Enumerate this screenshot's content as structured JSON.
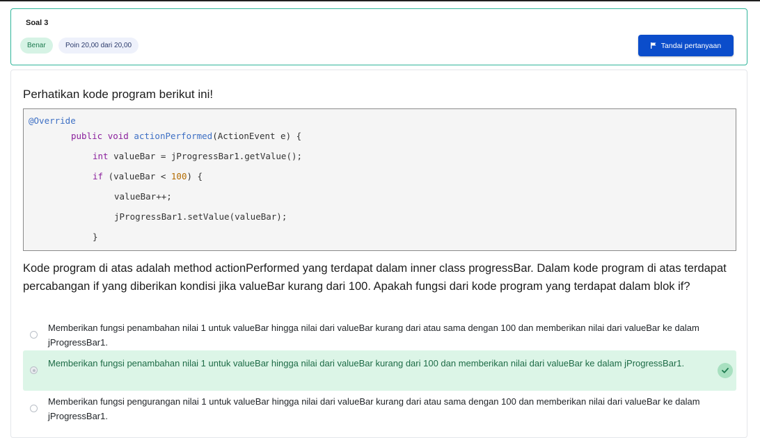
{
  "header": {
    "title": "Soal 3",
    "status_badge": "Benar",
    "points_badge": "Poin 20,00 dari 20,00",
    "flag_button_label": "Tandai pertanyaan"
  },
  "question": {
    "intro": "Perhatikan kode program berikut ini!",
    "code_lines": [
      "@Override",
      "public void actionPerformed(ActionEvent e) {",
      "int valueBar = jProgressBar1.getValue();",
      "if (valueBar < 100) {",
      "valueBar++;",
      "jProgressBar1.setValue(valueBar);",
      "}"
    ],
    "text": "Kode program di atas adalah method actionPerformed yang terdapat dalam inner class progressBar. Dalam kode program di atas terdapat percabangan if yang diberikan kondisi jika valueBar kurang dari 100. Apakah fungsi dari kode program yang terdapat dalam blok if?"
  },
  "options": [
    {
      "text": "Memberikan fungsi penambahan nilai 1 untuk valueBar hingga nilai dari valueBar kurang dari atau sama dengan 100 dan memberikan nilai dari valueBar ke dalam jProgressBar1.",
      "selected": false
    },
    {
      "text": "Memberikan fungsi penambahan nilai 1 untuk valueBar hingga nilai dari valueBar kurang dari 100 dan memberikan nilai dari valueBar ke dalam jProgressBar1.",
      "selected": true
    },
    {
      "text": "Memberikan fungsi pengurangan nilai 1 untuk valueBar hingga nilai dari valueBar kurang dari atau sama dengan 100 dan memberikan nilai dari valueBar ke dalam jProgressBar1.",
      "selected": false
    }
  ],
  "icons": {
    "flag": "flag-icon",
    "check": "check-icon"
  },
  "colors": {
    "accent_blue": "#0b4dcb",
    "correct_green": "#2fb59a",
    "correct_bg": "#dcf5e7"
  }
}
